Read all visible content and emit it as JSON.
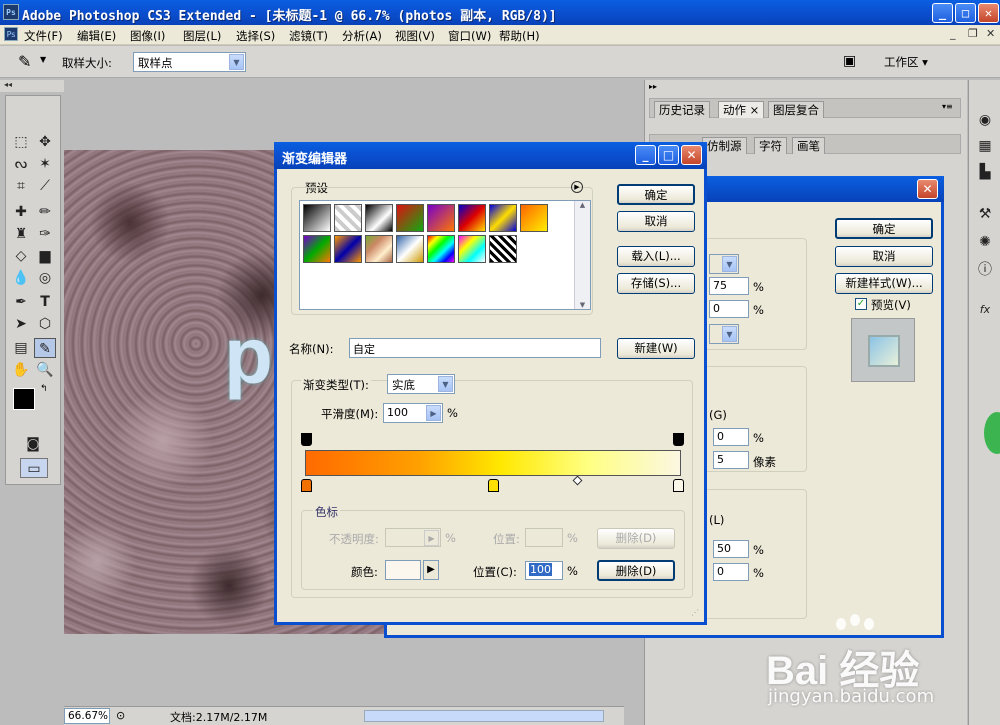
{
  "app": {
    "title": "Adobe Photoshop CS3 Extended - [未标题-1 @ 66.7% (photos 副本, RGB/8)]",
    "logo": "Ps"
  },
  "menu": [
    "文件(F)",
    "编辑(E)",
    "图像(I)",
    "图层(L)",
    "选择(S)",
    "滤镜(T)",
    "分析(A)",
    "视图(V)",
    "窗口(W)",
    "帮助(H)"
  ],
  "options": {
    "sample_size_label": "取样大小:",
    "sample_size_value": "取样点",
    "workspace": "工作区 ▾"
  },
  "panels": {
    "group1_tabs": [
      "历史记录",
      "动作 ×",
      "图层复合"
    ],
    "group2_tabs": [
      "仿制源",
      "字符",
      "画笔"
    ]
  },
  "canvas": {
    "letter": "p"
  },
  "status": {
    "zoom": "66.67%",
    "doc": "文档:2.17M/2.17M"
  },
  "layer_style": {
    "ok": "确定",
    "cancel": "取消",
    "new_style": "新建样式(W)...",
    "preview": "预览(V)",
    "v1": "75",
    "u1": "%",
    "v2": "0",
    "u2": "%",
    "lbl_g": "(G)",
    "v3": "0",
    "u3": "%",
    "v4": "5",
    "u4": "像素",
    "lbl_l": "(L)",
    "v5": "50",
    "u5": "%",
    "v6": "0",
    "u6": "%"
  },
  "gradient_editor": {
    "title": "渐变编辑器",
    "presets_label": "预设",
    "ok": "确定",
    "cancel": "取消",
    "load": "载入(L)...",
    "save": "存储(S)...",
    "name_label": "名称(N):",
    "name_value": "自定",
    "new": "新建(W)",
    "type_label": "渐变类型(T):",
    "type_value": "实底",
    "smooth_label": "平滑度(M):",
    "smooth_value": "100",
    "smooth_unit": "%",
    "stops_label": "色标",
    "opacity_label": "不透明度:",
    "opacity_unit": "%",
    "position_label_1": "位置:",
    "position_unit_1": "%",
    "delete_1": "删除(D)",
    "color_label": "颜色:",
    "position_label_2": "位置(C):",
    "position_value_2": "100",
    "position_unit_2": "%",
    "delete_2": "删除(D)"
  },
  "watermark": {
    "brand": "Bai 经验",
    "url": "jingyan.baidu.com"
  },
  "colors": {
    "xp_blue": "#0a4fd0",
    "dialog_bg": "#ece9d8"
  }
}
